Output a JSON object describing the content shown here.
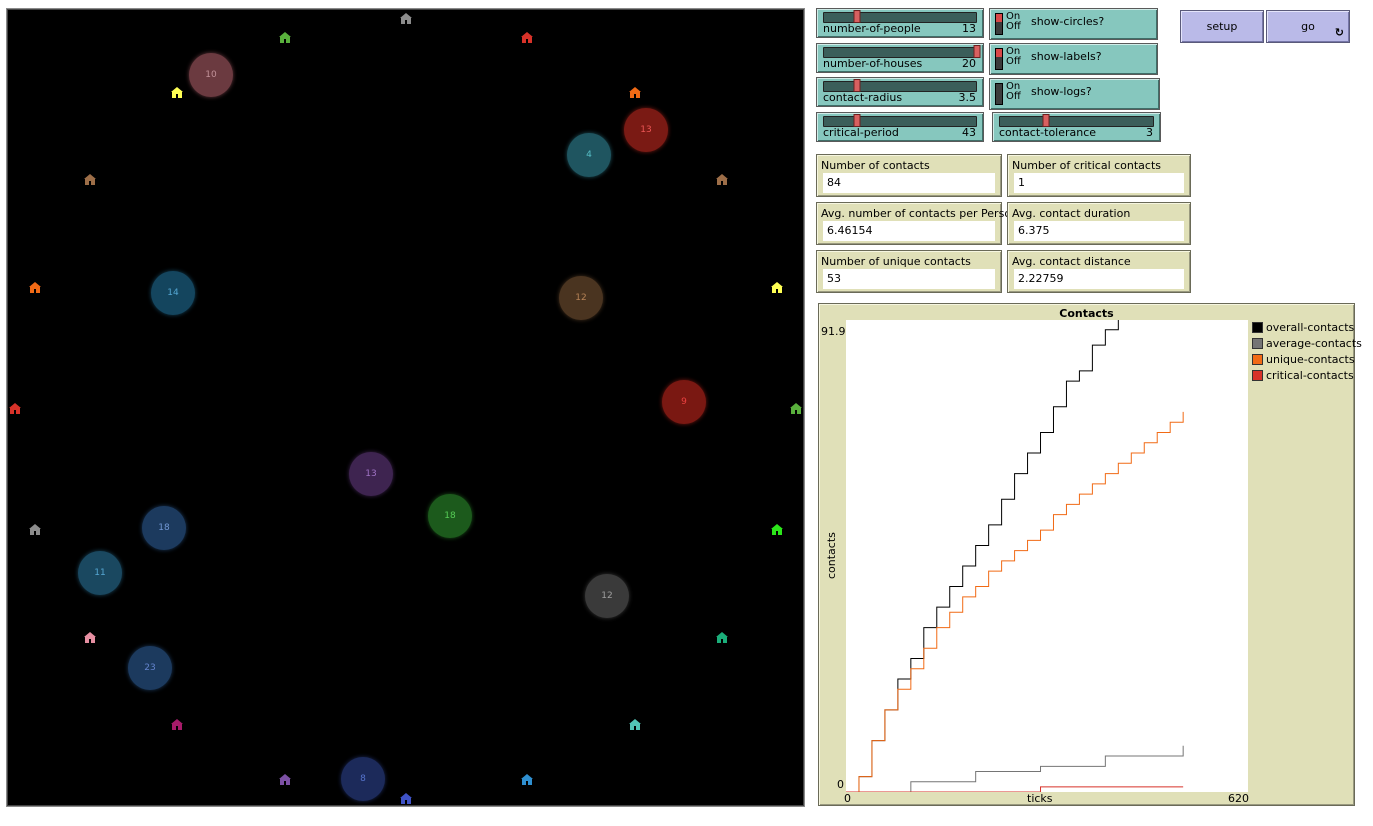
{
  "world": {
    "houses": [
      {
        "color": "#8c8c8c"
      },
      {
        "color": "#59b03c"
      },
      {
        "color": "#d73229"
      },
      {
        "color": "#ffff54"
      },
      {
        "color": "#f16a15"
      },
      {
        "color": "#9d6e48"
      },
      {
        "color": "#9d6e48"
      },
      {
        "color": "#f16a15"
      },
      {
        "color": "#ffff54"
      },
      {
        "color": "#d73229"
      },
      {
        "color": "#59b03c"
      },
      {
        "color": "#8c8c8c"
      },
      {
        "color": "#2ce61a"
      },
      {
        "color": "#e68fa2"
      },
      {
        "color": "#1bae7a"
      },
      {
        "color": "#a71b6a"
      },
      {
        "color": "#52c4b4"
      },
      {
        "color": "#7c50a4"
      },
      {
        "color": "#2f8fd0"
      },
      {
        "color": "#3f53c7"
      }
    ],
    "people": [
      {
        "label": "10",
        "color": "#6b3a40",
        "arrow": "#d0a0a8"
      },
      {
        "label": "13",
        "color": "#7a1a14",
        "arrow": "#ff6060"
      },
      {
        "label": "4",
        "color": "#1f5560",
        "arrow": "#60d0d8"
      },
      {
        "label": "14",
        "color": "#14455e",
        "arrow": "#60b8e8"
      },
      {
        "label": "12",
        "color": "#4a3420",
        "arrow": "#c89060"
      },
      {
        "label": "9",
        "color": "#7a1812",
        "arrow": "#ff4848"
      },
      {
        "label": "13",
        "color": "#3e2450",
        "arrow": "#b080d8"
      },
      {
        "label": "18",
        "color": "#1c3a5e",
        "arrow": "#80a8e8"
      },
      {
        "label": "18",
        "color": "#1c5a1c",
        "arrow": "#60e060"
      },
      {
        "label": "11",
        "color": "#1a4860",
        "arrow": "#60b8e8"
      },
      {
        "label": "12",
        "color": "#3a3a3a",
        "arrow": "#b0b0b0"
      },
      {
        "label": "23",
        "color": "#1c3a5e",
        "arrow": "#7090e0"
      },
      {
        "label": "8",
        "color": "#1c2a5a",
        "arrow": "#6080e0"
      }
    ]
  },
  "sliders": [
    {
      "name": "number-of-people",
      "value": "13",
      "fraction": 0.22
    },
    {
      "name": "number-of-houses",
      "value": "20",
      "fraction": 1.0
    },
    {
      "name": "contact-radius",
      "value": "3.5",
      "fraction": 0.22
    },
    {
      "name": "critical-period",
      "value": "43",
      "fraction": 0.22
    },
    {
      "name": "contact-tolerance",
      "value": "3",
      "fraction": 0.3
    }
  ],
  "switches": [
    {
      "name": "show-circles?",
      "on": "On",
      "off": "Off"
    },
    {
      "name": "show-labels?",
      "on": "On",
      "off": "Off"
    },
    {
      "name": "show-logs?",
      "on": "On",
      "off": "Off"
    }
  ],
  "buttons": {
    "setup": "setup",
    "go": "go",
    "forever_icon": "↻"
  },
  "monitors": [
    {
      "name": "Number of contacts",
      "value": "84"
    },
    {
      "name": "Number of critical contacts",
      "value": "1"
    },
    {
      "name": "Avg. number of contacts per Person",
      "value": "6.46154"
    },
    {
      "name": "Avg. contact duration",
      "value": "6.375"
    },
    {
      "name": "Number of unique contacts",
      "value": "53"
    },
    {
      "name": "Avg. contact distance",
      "value": "2.22759"
    }
  ],
  "plot": {
    "title": "Contacts",
    "xlabel": "ticks",
    "ylabel": "contacts",
    "xmin": "0",
    "xmax": "620",
    "ymin": "0",
    "ymax": "91.9",
    "legend": [
      {
        "name": "overall-contacts",
        "color": "#000000"
      },
      {
        "name": "average-contacts",
        "color": "#757575"
      },
      {
        "name": "unique-contacts",
        "color": "#f16a15"
      },
      {
        "name": "critical-contacts",
        "color": "#d73229"
      }
    ]
  },
  "chart_data": {
    "type": "line",
    "title": "Contacts",
    "xlabel": "ticks",
    "ylabel": "contacts",
    "xlim": [
      0,
      620
    ],
    "ylim": [
      0,
      91.9
    ],
    "series": [
      {
        "name": "overall-contacts",
        "color": "#000000",
        "x": [
          0,
          20,
          40,
          60,
          80,
          100,
          120,
          140,
          160,
          180,
          200,
          220,
          240,
          260,
          280,
          300,
          320,
          340,
          360,
          380,
          400,
          420,
          440,
          460,
          480,
          500,
          520
        ],
        "y": [
          0,
          3,
          10,
          16,
          22,
          26,
          32,
          36,
          40,
          44,
          48,
          52,
          57,
          62,
          66,
          70,
          75,
          80,
          82,
          87,
          90,
          93,
          97,
          100,
          104,
          108,
          112
        ]
      },
      {
        "name": "average-contacts",
        "color": "#757575",
        "x": [
          0,
          100,
          200,
          300,
          400,
          520
        ],
        "y": [
          0,
          2,
          4,
          5,
          7,
          9
        ]
      },
      {
        "name": "unique-contacts",
        "color": "#f16a15",
        "x": [
          0,
          20,
          40,
          60,
          80,
          100,
          120,
          140,
          160,
          180,
          200,
          220,
          240,
          260,
          280,
          300,
          320,
          340,
          360,
          380,
          400,
          420,
          440,
          460,
          480,
          500,
          520
        ],
        "y": [
          0,
          3,
          10,
          16,
          20,
          24,
          28,
          32,
          35,
          38,
          40,
          43,
          45,
          47,
          49,
          51,
          54,
          56,
          58,
          60,
          62,
          64,
          66,
          68,
          70,
          72,
          74
        ]
      },
      {
        "name": "critical-contacts",
        "color": "#d73229",
        "x": [
          0,
          100,
          200,
          300,
          400,
          520
        ],
        "y": [
          0,
          0,
          0,
          1,
          1,
          1
        ]
      }
    ]
  }
}
